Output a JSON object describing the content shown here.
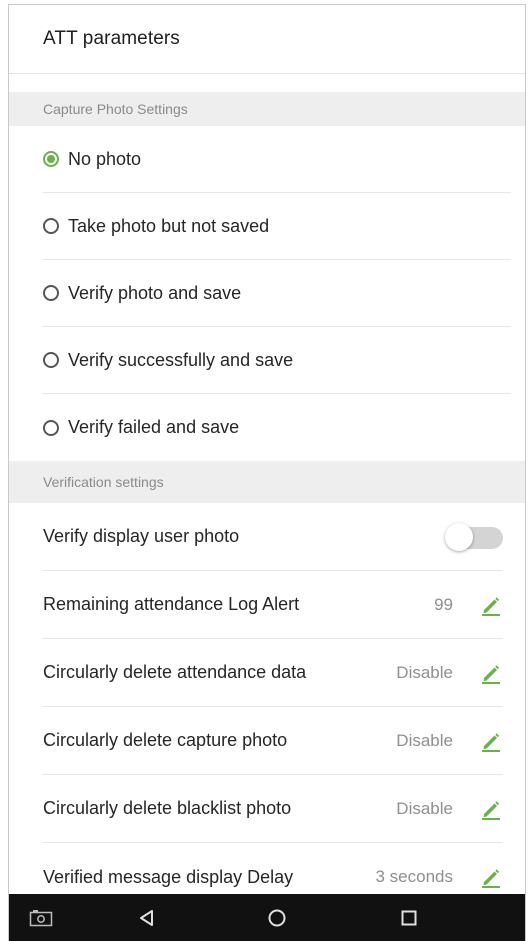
{
  "header": {
    "title": "ATT parameters"
  },
  "capture_section": {
    "title": "Capture Photo Settings",
    "selected_index": 0,
    "options": [
      {
        "label": "No photo",
        "checked": true
      },
      {
        "label": "Take photo but not saved",
        "checked": false
      },
      {
        "label": "Verify photo and save",
        "checked": false
      },
      {
        "label": "Verify successfully and save",
        "checked": false
      },
      {
        "label": "Verify failed and save",
        "checked": false
      }
    ]
  },
  "verification_section": {
    "title": "Verification settings",
    "display_user_photo": {
      "label": "Verify display user photo",
      "enabled": false
    },
    "rows": [
      {
        "label": "Remaining attendance Log Alert",
        "value": "99"
      },
      {
        "label": "Circularly delete attendance data",
        "value": "Disable"
      },
      {
        "label": "Circularly delete capture photo",
        "value": "Disable"
      },
      {
        "label": "Circularly delete blacklist photo",
        "value": "Disable"
      },
      {
        "label": "Verified message display Delay",
        "value": "3 seconds"
      }
    ]
  },
  "icons": {
    "edit": "pencil-icon",
    "nav": [
      "screenshot-icon",
      "back-icon",
      "home-icon",
      "recents-icon"
    ]
  },
  "colors": {
    "accent": "#6ab04c",
    "section_bg": "#eeeeee",
    "navbar_bg": "#111111"
  }
}
